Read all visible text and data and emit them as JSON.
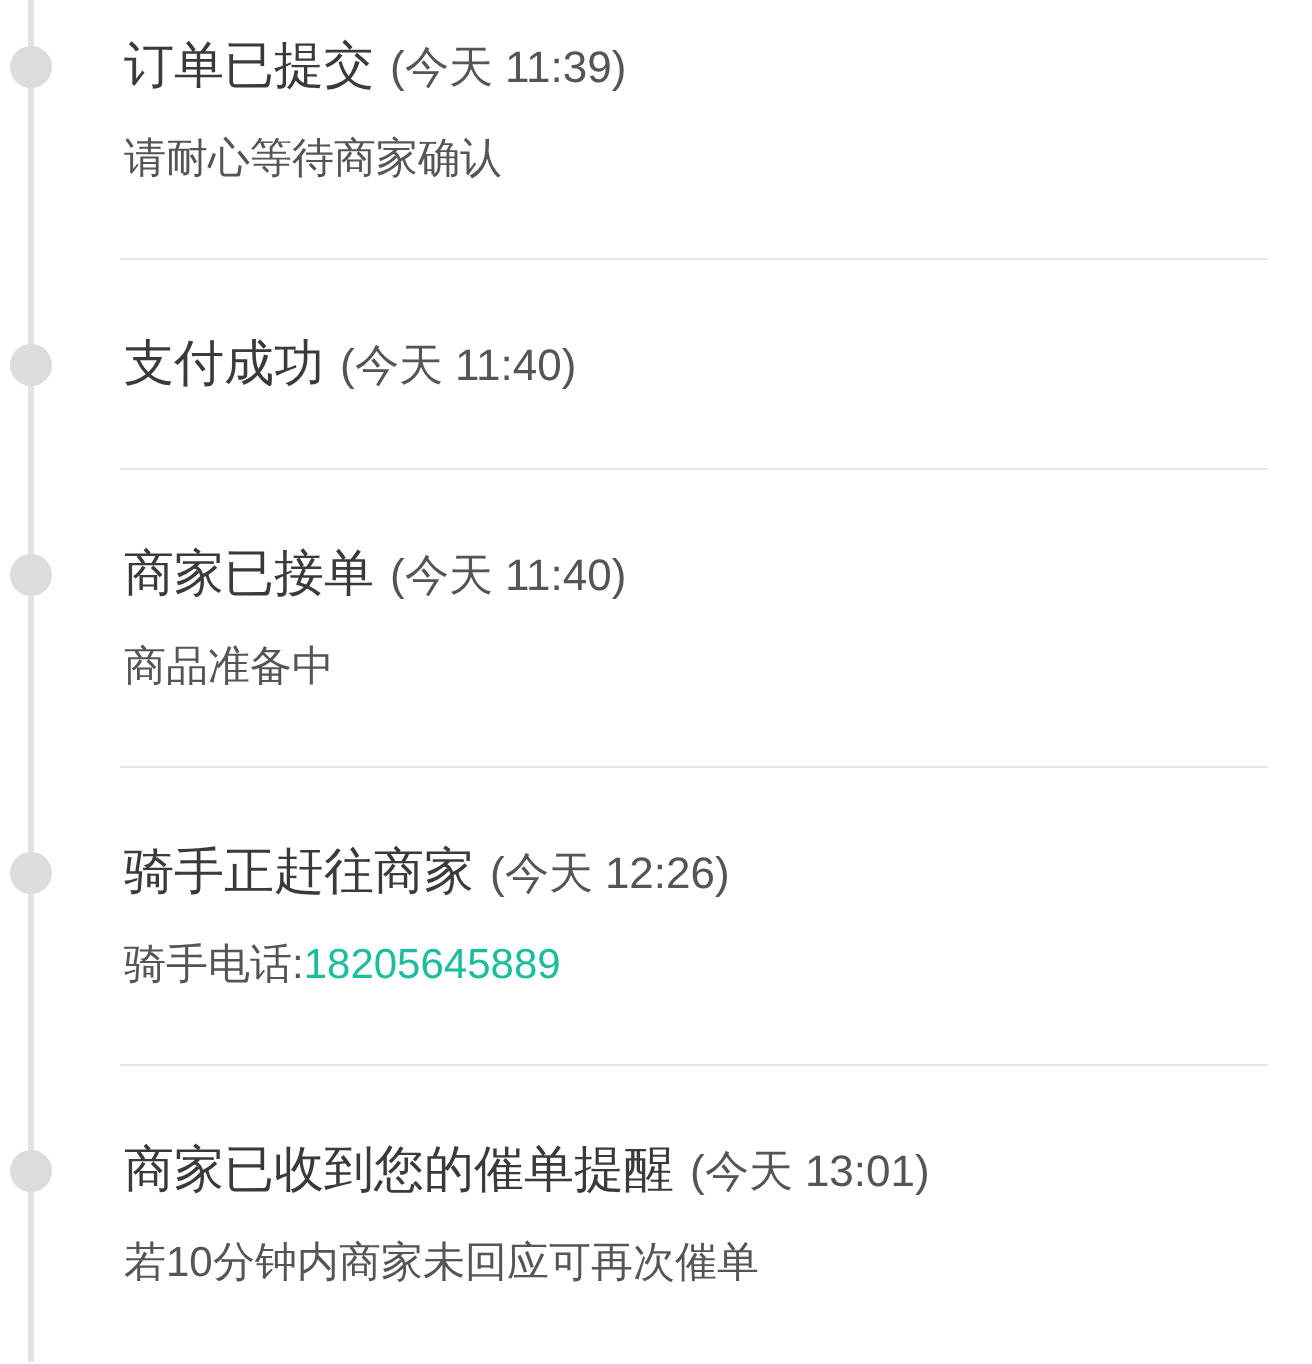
{
  "events": [
    {
      "title": "订单已提交",
      "time": "(今天 11:39)",
      "note": "请耐心等待商家确认"
    },
    {
      "title": "支付成功",
      "time": "(今天 11:40)"
    },
    {
      "title": "商家已接单",
      "time": "(今天 11:40)",
      "note": "商品准备中"
    },
    {
      "title": "骑手正赶往商家",
      "time": "(今天 12:26)",
      "note": "骑手电话:",
      "phone": "18205645889"
    },
    {
      "title": "商家已收到您的催单提醒",
      "time": "(今天 13:01)",
      "note": "若10分钟内商家未回应可再次催单"
    }
  ]
}
